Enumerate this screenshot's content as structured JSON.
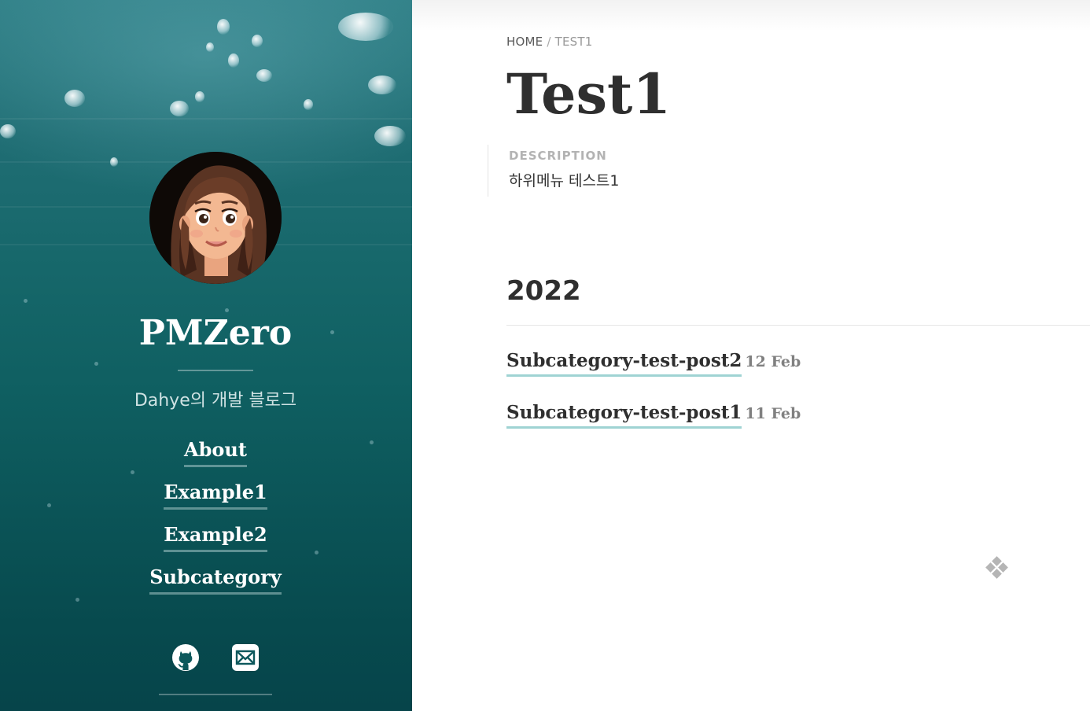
{
  "sidebar": {
    "site_title": "PMZero",
    "tagline": "Dahye의 개발 블로그",
    "nav": [
      {
        "label": "About"
      },
      {
        "label": "Example1"
      },
      {
        "label": "Example2"
      },
      {
        "label": "Subcategory"
      }
    ],
    "social": [
      {
        "icon": "github-icon"
      },
      {
        "icon": "mail-icon"
      }
    ]
  },
  "breadcrumb": {
    "home": "HOME",
    "separator": "/",
    "current": "TEST1"
  },
  "page": {
    "title": "Test1",
    "description_label": "DESCRIPTION",
    "description_text": "하위메뉴 테스트1"
  },
  "archive": {
    "year": "2022",
    "posts": [
      {
        "title": "Subcategory-test-post2",
        "date": "12 Feb"
      },
      {
        "title": "Subcategory-test-post1",
        "date": "11 Feb"
      }
    ]
  },
  "colors": {
    "link_underline": "#9fd3d3",
    "sidebar_teal": "#0f5f61",
    "heading": "#2f2f2f"
  },
  "fab_icon": "diamond-grid-icon"
}
